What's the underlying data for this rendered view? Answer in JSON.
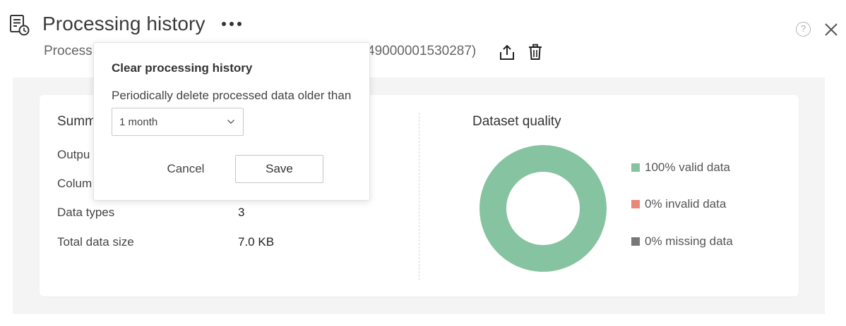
{
  "header": {
    "title": "Processing history",
    "icon": "processing-history-icon",
    "help_label": "?"
  },
  "subtitle": {
    "left": "Process",
    "right": "49000001530287)"
  },
  "summary": {
    "title": "Summ",
    "rows": [
      {
        "label": "Outpu",
        "value": ""
      },
      {
        "label": "Colum",
        "value": ""
      },
      {
        "label": "Data types",
        "value": "3"
      },
      {
        "label": "Total data size",
        "value": "7.0 KB"
      }
    ]
  },
  "quality": {
    "title": "Dataset quality",
    "legend": [
      {
        "label": "100% valid data",
        "color": "#86c3a1"
      },
      {
        "label": "0% invalid data",
        "color": "#e8877a"
      },
      {
        "label": "0% missing data",
        "color": "#777777"
      }
    ],
    "valid_percent": 100
  },
  "popover": {
    "title": "Clear processing history",
    "description": "Periodically delete processed data older than",
    "select_value": "1 month",
    "cancel_label": "Cancel",
    "save_label": "Save"
  },
  "colors": {
    "accent_green": "#86c3a1",
    "backdrop": "#f4f4f4"
  }
}
